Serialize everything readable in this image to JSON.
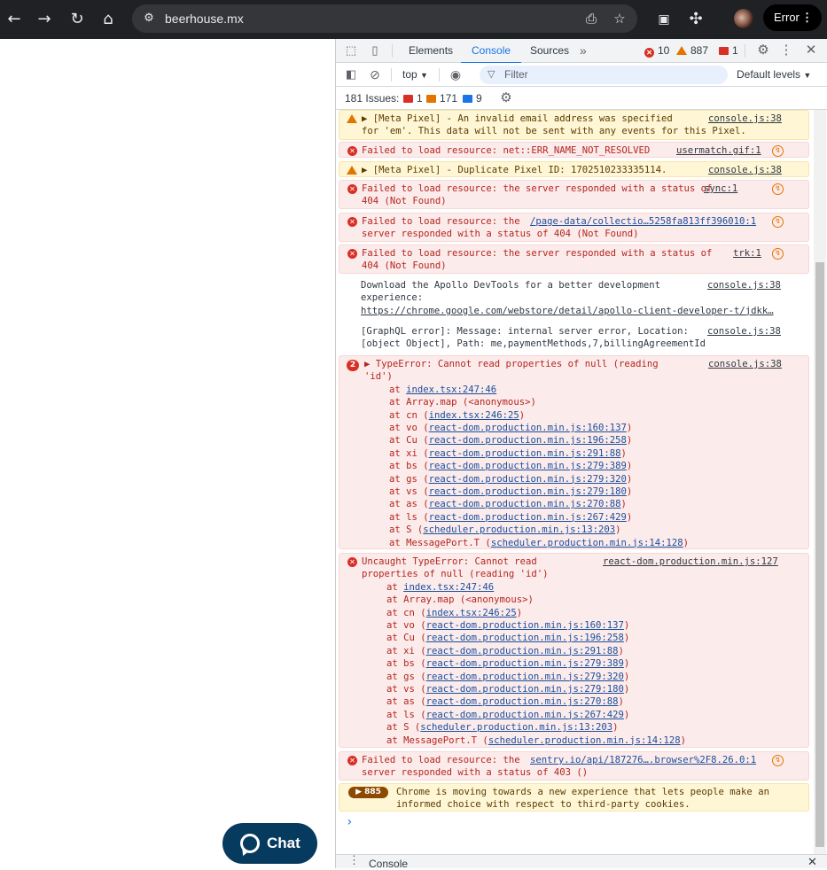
{
  "browser": {
    "url": "beerhouse.mx",
    "error_button": "Error"
  },
  "page": {
    "chat_label": "Chat"
  },
  "devtools": {
    "tabs": [
      "Elements",
      "Console",
      "Sources"
    ],
    "active_tab": "Console",
    "more_tabs": "»",
    "counts": {
      "errors": "10",
      "warnings": "887",
      "messages": "1"
    },
    "toolbar": {
      "context": "top",
      "filter_placeholder": "Filter",
      "levels": "Default levels"
    },
    "issues": {
      "label": "181 Issues:",
      "errors": "1",
      "warnings": "171",
      "info": "9"
    },
    "log": [
      {
        "type": "warn",
        "lines": [
          "▶ [Meta Pixel] - An invalid email address was specified",
          "for 'em'. This data will not be sent with any events for this Pixel."
        ],
        "source": "console.js:38"
      },
      {
        "type": "err",
        "lines": [
          "Failed to load resource: net::ERR_NAME_NOT_RESOLVED"
        ],
        "source": "usermatch.gif:1"
      },
      {
        "type": "warn",
        "lines": [
          "▶ [Meta Pixel] - Duplicate Pixel ID: 1702510233335114."
        ],
        "source": "console.js:38"
      },
      {
        "type": "err",
        "lines": [
          "Failed to load resource: the server responded with a status of",
          "404 (Not Found)"
        ],
        "source": "sync:1"
      },
      {
        "type": "err",
        "lines": [
          "Failed to load resource: the",
          "server responded with a status of 404 (Not Found)"
        ],
        "source": "/page-data/collectio…5258fa813ff396010:1"
      },
      {
        "type": "err",
        "lines": [
          "Failed to load resource: the server responded with a status of",
          "404 (Not Found)"
        ],
        "source": "trk:1"
      },
      {
        "type": "info",
        "lines": [
          "Download the Apollo DevTools for a better development",
          "experience:"
        ],
        "link": "https://chrome.google.com/webstore/detail/apollo-client-developer-t/jdkk…",
        "source": "console.js:38"
      },
      {
        "type": "info",
        "lines": [
          "[GraphQL error]: Message: internal server error, Location:",
          "[object Object], Path: me,paymentMethods,7,billingAgreementId"
        ],
        "source": "console.js:38"
      },
      {
        "type": "err",
        "badge": "2",
        "lines": [
          "▶ TypeError: Cannot read properties of null (reading",
          "'id')"
        ],
        "source": "console.js:38",
        "stack": [
          {
            "pre": "at ",
            "link": "index.tsx:247:46",
            "post": ""
          },
          {
            "pre": "at Array.map (<anonymous>)",
            "link": "",
            "post": ""
          },
          {
            "pre": "at cn (",
            "link": "index.tsx:246:25",
            "post": ")"
          },
          {
            "pre": "at vo (",
            "link": "react-dom.production.min.js:160:137",
            "post": ")"
          },
          {
            "pre": "at Cu (",
            "link": "react-dom.production.min.js:196:258",
            "post": ")"
          },
          {
            "pre": "at xi (",
            "link": "react-dom.production.min.js:291:88",
            "post": ")"
          },
          {
            "pre": "at bs (",
            "link": "react-dom.production.min.js:279:389",
            "post": ")"
          },
          {
            "pre": "at gs (",
            "link": "react-dom.production.min.js:279:320",
            "post": ")"
          },
          {
            "pre": "at vs (",
            "link": "react-dom.production.min.js:279:180",
            "post": ")"
          },
          {
            "pre": "at as (",
            "link": "react-dom.production.min.js:270:88",
            "post": ")"
          },
          {
            "pre": "at ls (",
            "link": "react-dom.production.min.js:267:429",
            "post": ")"
          },
          {
            "pre": "at S (",
            "link": "scheduler.production.min.js:13:203",
            "post": ")"
          },
          {
            "pre": "at MessagePort.T (",
            "link": "scheduler.production.min.js:14:128",
            "post": ")"
          }
        ]
      },
      {
        "type": "err",
        "lines": [
          "Uncaught TypeError: Cannot read",
          "properties of null (reading 'id')"
        ],
        "source": "react-dom.production.min.js:127",
        "stack": [
          {
            "pre": "at ",
            "link": "index.tsx:247:46",
            "post": ""
          },
          {
            "pre": "at Array.map (<anonymous>)",
            "link": "",
            "post": ""
          },
          {
            "pre": "at cn (",
            "link": "index.tsx:246:25",
            "post": ")"
          },
          {
            "pre": "at vo (",
            "link": "react-dom.production.min.js:160:137",
            "post": ")"
          },
          {
            "pre": "at Cu (",
            "link": "react-dom.production.min.js:196:258",
            "post": ")"
          },
          {
            "pre": "at xi (",
            "link": "react-dom.production.min.js:291:88",
            "post": ")"
          },
          {
            "pre": "at bs (",
            "link": "react-dom.production.min.js:279:389",
            "post": ")"
          },
          {
            "pre": "at gs (",
            "link": "react-dom.production.min.js:279:320",
            "post": ")"
          },
          {
            "pre": "at vs (",
            "link": "react-dom.production.min.js:279:180",
            "post": ")"
          },
          {
            "pre": "at as (",
            "link": "react-dom.production.min.js:270:88",
            "post": ")"
          },
          {
            "pre": "at ls (",
            "link": "react-dom.production.min.js:267:429",
            "post": ")"
          },
          {
            "pre": "at S (",
            "link": "scheduler.production.min.js:13:203",
            "post": ")"
          },
          {
            "pre": "at MessagePort.T (",
            "link": "scheduler.production.min.js:14:128",
            "post": ")"
          }
        ]
      },
      {
        "type": "err",
        "lines": [
          "Failed to load resource: the",
          "server responded with a status of 403 ()"
        ],
        "source": "sentry.io/api/187276….browser%2F8.26.0:1"
      },
      {
        "type": "warn",
        "badge": "885",
        "lines": [
          "Chrome is moving towards a new experience that lets people make an",
          "informed choice with respect to third-party cookies."
        ]
      }
    ],
    "prompt": "›",
    "drawer_label": "Console"
  }
}
